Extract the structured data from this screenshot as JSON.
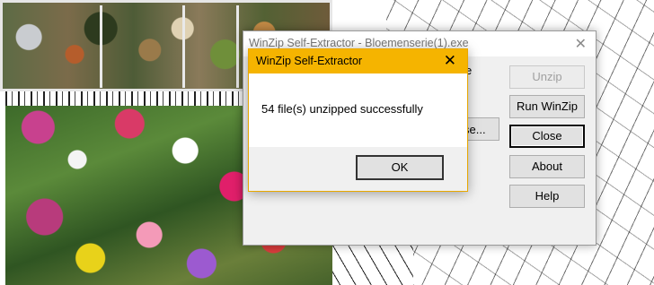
{
  "background_window": {
    "title": "WinZip Self-Extractor - Bloemenserie(1).exe",
    "close_glyph": "✕",
    "partial_label": "e",
    "browse_label": "se...",
    "buttons": [
      {
        "label": "Unzip",
        "enabled": false
      },
      {
        "label": "Run WinZip",
        "enabled": true
      },
      {
        "label": "Close",
        "enabled": true,
        "focused": true
      },
      {
        "label": "About",
        "enabled": true
      },
      {
        "label": "Help",
        "enabled": true
      }
    ]
  },
  "message_box": {
    "title": "WinZip Self-Extractor",
    "close_glyph": "✕",
    "message": "54 file(s) unzipped successfully",
    "ok_label": "OK",
    "accent_color": "#f5b400"
  }
}
